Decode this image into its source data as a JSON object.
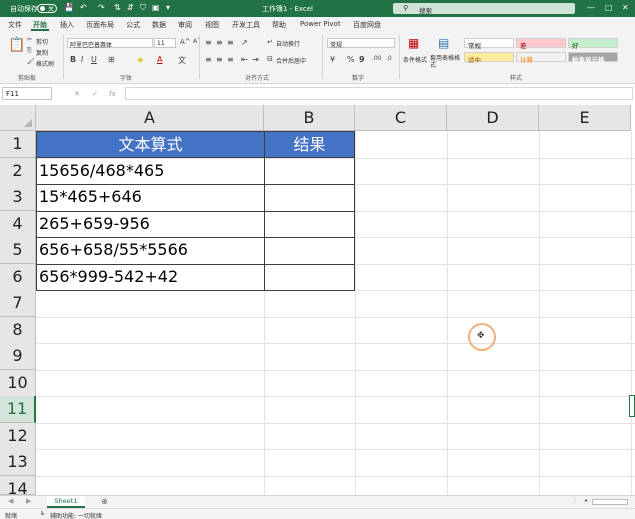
{
  "titlebar": {
    "autosave_label": "自动保存",
    "toggle_state": "关",
    "doc_title": "工作簿1 - Excel",
    "search_placeholder": "搜索",
    "accent": "#217346"
  },
  "menu": {
    "tabs": [
      "文件",
      "开始",
      "插入",
      "页面布局",
      "公式",
      "数据",
      "审阅",
      "视图",
      "开发工具",
      "帮助",
      "Power Pivot",
      "百度网盘"
    ],
    "active": "开始"
  },
  "ribbon": {
    "clipboard": {
      "cut": "剪切",
      "copy": "复制",
      "format_painter": "格式刷",
      "label": "剪贴板"
    },
    "font": {
      "name": "阿里巴巴普惠体",
      "size": "11",
      "label": "字体"
    },
    "alignment": {
      "wrap": "自动换行",
      "merge": "合并后居中",
      "label": "对齐方式"
    },
    "number": {
      "format": "常规",
      "label": "数字"
    },
    "styles": {
      "conditional": "条件格式",
      "table_format": "套用表格格式",
      "normal": "常规",
      "bad": "差",
      "good": "好",
      "neutral": "适中",
      "calculation": "计算",
      "check_cell": "检查单元格",
      "label": "样式"
    }
  },
  "formula_bar": {
    "name_box": "F11",
    "value": ""
  },
  "columns": [
    "A",
    "B",
    "C",
    "D",
    "E"
  ],
  "rows": [
    "1",
    "2",
    "3",
    "4",
    "5",
    "6",
    "7",
    "8",
    "9",
    "10",
    "11",
    "12",
    "13",
    "14"
  ],
  "selected_row": "11",
  "table": {
    "header": [
      "文本算式",
      "结果"
    ],
    "header_color": "#4472c4",
    "expressions": [
      "15656/468*465",
      "15*465+646",
      "265+659-956",
      "656+658/55*5566",
      "656*999-542+42"
    ],
    "results": [
      "",
      "",
      "",
      "",
      ""
    ]
  },
  "sheet": {
    "name": "Sheet1"
  },
  "status": {
    "ready": "就绪",
    "accessibility": "辅助功能: 一切就绪"
  }
}
